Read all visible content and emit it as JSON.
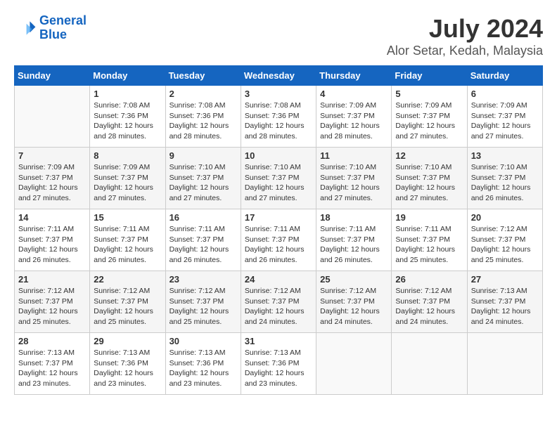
{
  "header": {
    "logo_line1": "General",
    "logo_line2": "Blue",
    "title": "July 2024",
    "subtitle": "Alor Setar, Kedah, Malaysia"
  },
  "calendar": {
    "days_of_week": [
      "Sunday",
      "Monday",
      "Tuesday",
      "Wednesday",
      "Thursday",
      "Friday",
      "Saturday"
    ],
    "weeks": [
      [
        {
          "day": "",
          "info": ""
        },
        {
          "day": "1",
          "info": "Sunrise: 7:08 AM\nSunset: 7:36 PM\nDaylight: 12 hours\nand 28 minutes."
        },
        {
          "day": "2",
          "info": "Sunrise: 7:08 AM\nSunset: 7:36 PM\nDaylight: 12 hours\nand 28 minutes."
        },
        {
          "day": "3",
          "info": "Sunrise: 7:08 AM\nSunset: 7:36 PM\nDaylight: 12 hours\nand 28 minutes."
        },
        {
          "day": "4",
          "info": "Sunrise: 7:09 AM\nSunset: 7:37 PM\nDaylight: 12 hours\nand 28 minutes."
        },
        {
          "day": "5",
          "info": "Sunrise: 7:09 AM\nSunset: 7:37 PM\nDaylight: 12 hours\nand 27 minutes."
        },
        {
          "day": "6",
          "info": "Sunrise: 7:09 AM\nSunset: 7:37 PM\nDaylight: 12 hours\nand 27 minutes."
        }
      ],
      [
        {
          "day": "7",
          "info": "Sunrise: 7:09 AM\nSunset: 7:37 PM\nDaylight: 12 hours\nand 27 minutes."
        },
        {
          "day": "8",
          "info": "Sunrise: 7:09 AM\nSunset: 7:37 PM\nDaylight: 12 hours\nand 27 minutes."
        },
        {
          "day": "9",
          "info": "Sunrise: 7:10 AM\nSunset: 7:37 PM\nDaylight: 12 hours\nand 27 minutes."
        },
        {
          "day": "10",
          "info": "Sunrise: 7:10 AM\nSunset: 7:37 PM\nDaylight: 12 hours\nand 27 minutes."
        },
        {
          "day": "11",
          "info": "Sunrise: 7:10 AM\nSunset: 7:37 PM\nDaylight: 12 hours\nand 27 minutes."
        },
        {
          "day": "12",
          "info": "Sunrise: 7:10 AM\nSunset: 7:37 PM\nDaylight: 12 hours\nand 27 minutes."
        },
        {
          "day": "13",
          "info": "Sunrise: 7:10 AM\nSunset: 7:37 PM\nDaylight: 12 hours\nand 26 minutes."
        }
      ],
      [
        {
          "day": "14",
          "info": "Sunrise: 7:11 AM\nSunset: 7:37 PM\nDaylight: 12 hours\nand 26 minutes."
        },
        {
          "day": "15",
          "info": "Sunrise: 7:11 AM\nSunset: 7:37 PM\nDaylight: 12 hours\nand 26 minutes."
        },
        {
          "day": "16",
          "info": "Sunrise: 7:11 AM\nSunset: 7:37 PM\nDaylight: 12 hours\nand 26 minutes."
        },
        {
          "day": "17",
          "info": "Sunrise: 7:11 AM\nSunset: 7:37 PM\nDaylight: 12 hours\nand 26 minutes."
        },
        {
          "day": "18",
          "info": "Sunrise: 7:11 AM\nSunset: 7:37 PM\nDaylight: 12 hours\nand 26 minutes."
        },
        {
          "day": "19",
          "info": "Sunrise: 7:11 AM\nSunset: 7:37 PM\nDaylight: 12 hours\nand 25 minutes."
        },
        {
          "day": "20",
          "info": "Sunrise: 7:12 AM\nSunset: 7:37 PM\nDaylight: 12 hours\nand 25 minutes."
        }
      ],
      [
        {
          "day": "21",
          "info": "Sunrise: 7:12 AM\nSunset: 7:37 PM\nDaylight: 12 hours\nand 25 minutes."
        },
        {
          "day": "22",
          "info": "Sunrise: 7:12 AM\nSunset: 7:37 PM\nDaylight: 12 hours\nand 25 minutes."
        },
        {
          "day": "23",
          "info": "Sunrise: 7:12 AM\nSunset: 7:37 PM\nDaylight: 12 hours\nand 25 minutes."
        },
        {
          "day": "24",
          "info": "Sunrise: 7:12 AM\nSunset: 7:37 PM\nDaylight: 12 hours\nand 24 minutes."
        },
        {
          "day": "25",
          "info": "Sunrise: 7:12 AM\nSunset: 7:37 PM\nDaylight: 12 hours\nand 24 minutes."
        },
        {
          "day": "26",
          "info": "Sunrise: 7:12 AM\nSunset: 7:37 PM\nDaylight: 12 hours\nand 24 minutes."
        },
        {
          "day": "27",
          "info": "Sunrise: 7:13 AM\nSunset: 7:37 PM\nDaylight: 12 hours\nand 24 minutes."
        }
      ],
      [
        {
          "day": "28",
          "info": "Sunrise: 7:13 AM\nSunset: 7:37 PM\nDaylight: 12 hours\nand 23 minutes."
        },
        {
          "day": "29",
          "info": "Sunrise: 7:13 AM\nSunset: 7:36 PM\nDaylight: 12 hours\nand 23 minutes."
        },
        {
          "day": "30",
          "info": "Sunrise: 7:13 AM\nSunset: 7:36 PM\nDaylight: 12 hours\nand 23 minutes."
        },
        {
          "day": "31",
          "info": "Sunrise: 7:13 AM\nSunset: 7:36 PM\nDaylight: 12 hours\nand 23 minutes."
        },
        {
          "day": "",
          "info": ""
        },
        {
          "day": "",
          "info": ""
        },
        {
          "day": "",
          "info": ""
        }
      ]
    ]
  }
}
